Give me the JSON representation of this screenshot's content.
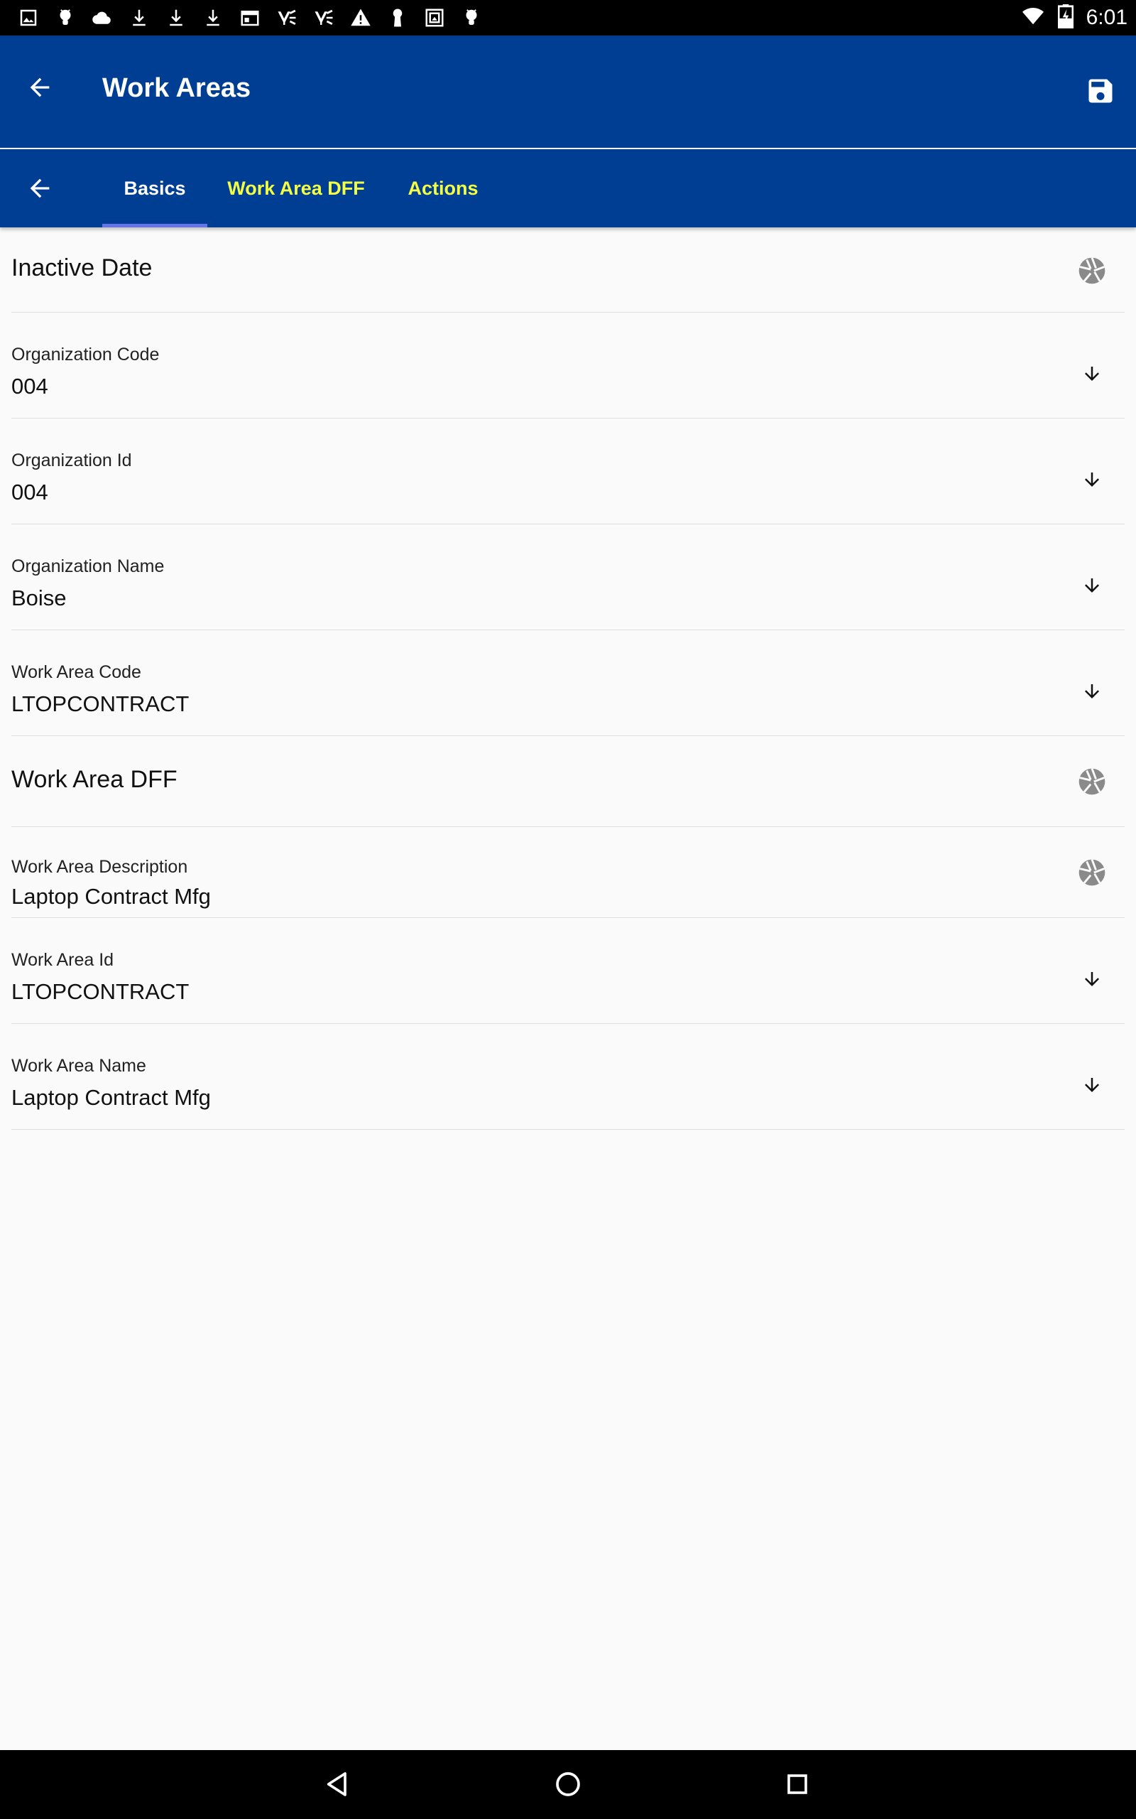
{
  "status_bar": {
    "time": "6:01",
    "left_icons": [
      "image-icon",
      "android-icon",
      "cloud-icon",
      "download-icon",
      "download-icon",
      "download-icon",
      "calendar-icon",
      "yammer-icon",
      "yammer-icon",
      "warning-icon",
      "keyhole-icon",
      "image-box-icon",
      "android-icon"
    ],
    "right_icons": [
      "wifi-icon",
      "battery-charging-icon"
    ]
  },
  "app_bar": {
    "title": "Work Areas",
    "back_icon": "arrow-back-icon",
    "save_icon": "save-icon"
  },
  "tabs": [
    {
      "label": "Basics",
      "active": true
    },
    {
      "label": "Work Area DFF",
      "active": false
    },
    {
      "label": "Actions",
      "active": false
    }
  ],
  "colors": {
    "app_bar": "#003e94",
    "active_tab_text": "#ffffff",
    "inactive_tab_text": "#f4ff44",
    "tab_indicator": "#6674e6",
    "background": "#fafafa"
  },
  "fields": [
    {
      "label": "Inactive Date",
      "value": "",
      "trailing_icon": "aperture-icon"
    },
    {
      "label": "Organization Code",
      "value": "004",
      "trailing_icon": "arrow-down-icon"
    },
    {
      "label": "Organization Id",
      "value": "004",
      "trailing_icon": "arrow-down-icon"
    },
    {
      "label": "Organization Name",
      "value": "Boise",
      "trailing_icon": "arrow-down-icon"
    },
    {
      "label": "Work Area Code",
      "value": "LTOPCONTRACT",
      "trailing_icon": "arrow-down-icon"
    },
    {
      "label": "Work Area DFF",
      "value": "",
      "trailing_icon": "aperture-icon"
    },
    {
      "label": "Work Area Description",
      "value": "Laptop Contract Mfg",
      "trailing_icon": "aperture-icon"
    },
    {
      "label": "Work Area Id",
      "value": "LTOPCONTRACT",
      "trailing_icon": "arrow-down-icon"
    },
    {
      "label": "Work Area Name",
      "value": "Laptop Contract Mfg",
      "trailing_icon": "arrow-down-icon"
    }
  ],
  "nav_bar": [
    "back-triangle-icon",
    "home-circle-icon",
    "recents-square-icon"
  ]
}
